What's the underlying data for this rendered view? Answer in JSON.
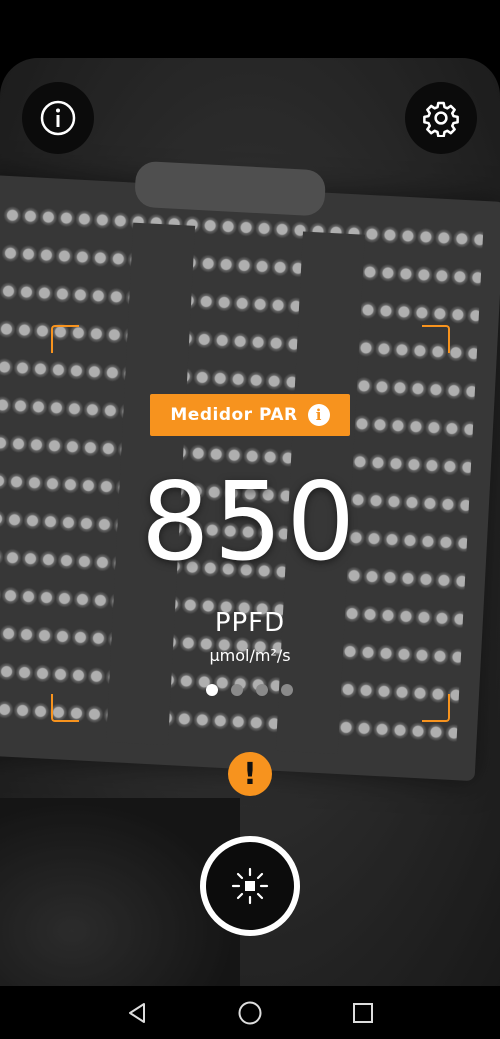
{
  "header": {
    "info_icon": "info-circle-icon",
    "settings_icon": "gear-icon"
  },
  "meter": {
    "mode_label": "Medidor PAR",
    "mode_info_glyph": "i",
    "value": "850",
    "unit": "PPFD",
    "unit_detail": "μmol/m²/s",
    "page_count": 4,
    "active_page": 1,
    "warning_glyph": "!"
  },
  "controls": {
    "capture_icon": "light-sun-icon"
  },
  "navigation": {
    "back_icon": "triangle-back-icon",
    "home_icon": "circle-home-icon",
    "recents_icon": "square-recents-icon"
  },
  "colors": {
    "accent": "#f7931e",
    "background": "#000000"
  }
}
